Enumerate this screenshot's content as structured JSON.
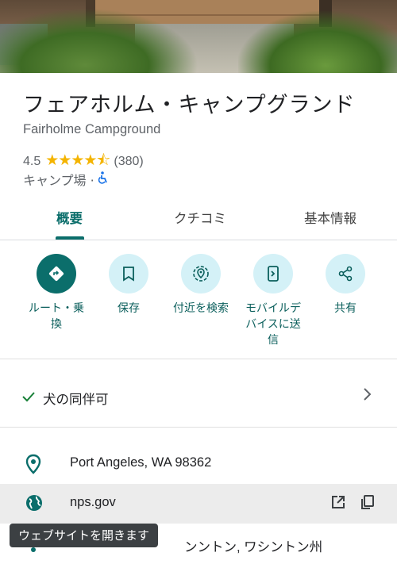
{
  "place": {
    "title": "フェアホルム・キャンプグランド",
    "subtitle": "Fairholme Campground",
    "rating": "4.5",
    "stars": "★★★★⯪",
    "review_count": "(380)",
    "category": "キャンプ場 ·",
    "accessibility_icon": "wheelchair-icon"
  },
  "tabs": [
    {
      "label": "概要",
      "active": true
    },
    {
      "label": "クチコミ",
      "active": false
    },
    {
      "label": "基本情報",
      "active": false
    }
  ],
  "actions": [
    {
      "label": "ルート・乗\n換",
      "icon": "directions-icon"
    },
    {
      "label": "保存",
      "icon": "bookmark-icon"
    },
    {
      "label": "付近を検索",
      "icon": "nearby-icon"
    },
    {
      "label": "モバイルデ\nバイスに送\n信",
      "icon": "send-to-phone-icon"
    },
    {
      "label": "共有",
      "icon": "share-icon"
    }
  ],
  "amenity": {
    "label": "犬の同伴可"
  },
  "info": {
    "address": "Port Angeles, WA 98362",
    "website": "nps.gov",
    "plus_code": "ンントン, ワシントン州"
  },
  "tooltip": "ウェブサイトを開きます",
  "colors": {
    "accent": "#0b6e6b",
    "action_bg": "#d4f1f7",
    "star": "#f4b400"
  }
}
